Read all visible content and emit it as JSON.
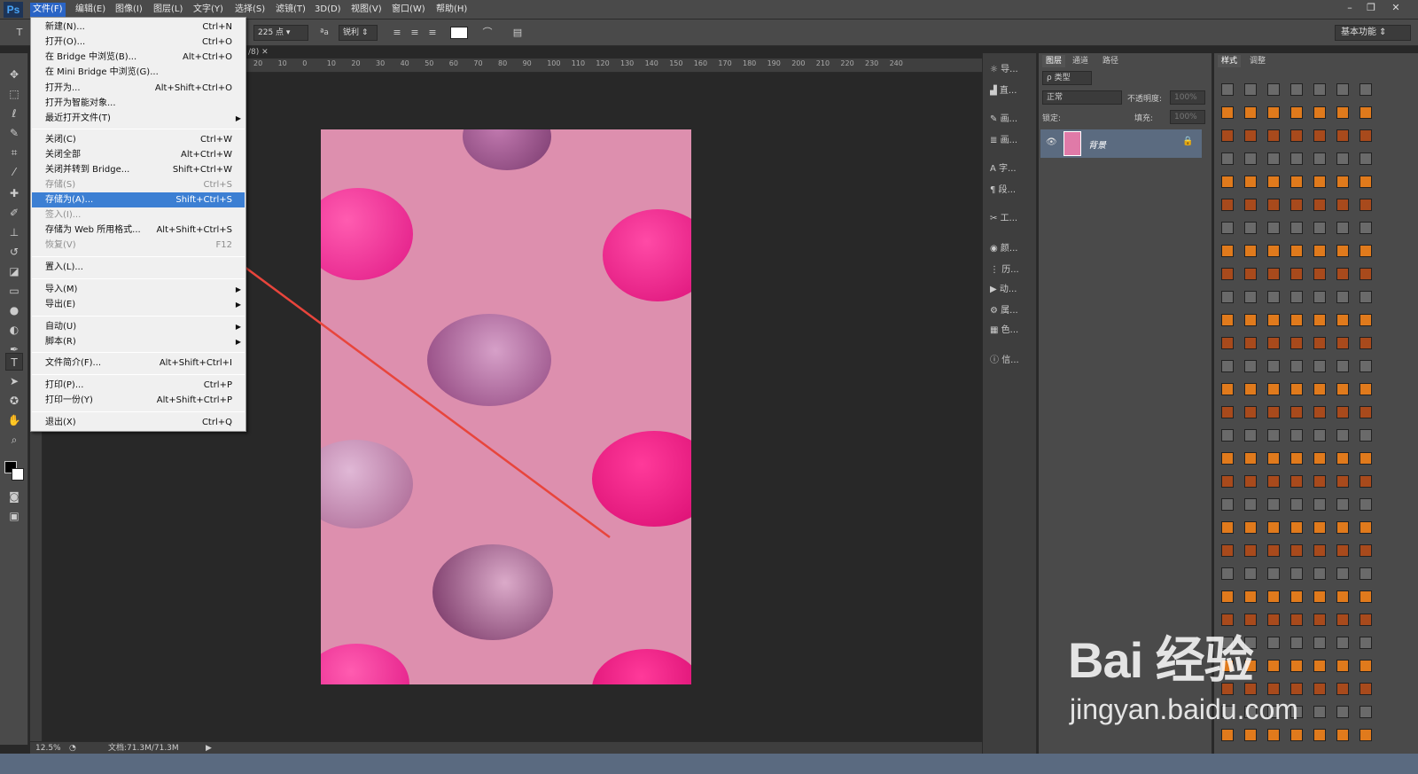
{
  "app": {
    "logo": "Ps",
    "menus": [
      "文件(F)",
      "编辑(E)",
      "图像(I)",
      "图层(L)",
      "文字(Y)",
      "选择(S)",
      "滤镜(T)",
      "3D(D)",
      "视图(V)",
      "窗口(W)",
      "帮助(H)"
    ],
    "active_menu": "文件(F)"
  },
  "options": {
    "font_size": "225 点",
    "aa_label": "ªa",
    "aa_mode": "锐利",
    "workspace": "基本功能"
  },
  "document": {
    "tab_label": "/8)",
    "ruler_ticks": [
      "20",
      "10",
      "0",
      "10",
      "20",
      "30",
      "40",
      "50",
      "60",
      "70",
      "80",
      "90",
      "100",
      "110",
      "120",
      "130",
      "140",
      "150",
      "160",
      "170",
      "180",
      "190",
      "200",
      "210",
      "220",
      "230",
      "240"
    ]
  },
  "status": {
    "zoom": "12.5%",
    "doc_info": "文档:71.3M/71.3M"
  },
  "file_menu": {
    "items": [
      {
        "label": "新建(N)...",
        "shortcut": "Ctrl+N"
      },
      {
        "label": "打开(O)...",
        "shortcut": "Ctrl+O"
      },
      {
        "label": "在 Bridge 中浏览(B)...",
        "shortcut": "Alt+Ctrl+O"
      },
      {
        "label": "在 Mini Bridge 中浏览(G)...",
        "shortcut": ""
      },
      {
        "label": "打开为...",
        "shortcut": "Alt+Shift+Ctrl+O"
      },
      {
        "label": "打开为智能对象...",
        "shortcut": ""
      },
      {
        "label": "最近打开文件(T)",
        "shortcut": ""
      },
      {
        "label": "关闭(C)",
        "shortcut": "Ctrl+W"
      },
      {
        "label": "关闭全部",
        "shortcut": "Alt+Ctrl+W"
      },
      {
        "label": "关闭并转到 Bridge...",
        "shortcut": "Shift+Ctrl+W"
      },
      {
        "label": "存储(S)",
        "shortcut": "Ctrl+S"
      },
      {
        "label": "存储为(A)...",
        "shortcut": "Shift+Ctrl+S"
      },
      {
        "label": "签入(I)...",
        "shortcut": ""
      },
      {
        "label": "存储为 Web 所用格式...",
        "shortcut": "Alt+Shift+Ctrl+S"
      },
      {
        "label": "恢复(V)",
        "shortcut": "F12"
      },
      {
        "label": "置入(L)...",
        "shortcut": ""
      },
      {
        "label": "导入(M)",
        "shortcut": ""
      },
      {
        "label": "导出(E)",
        "shortcut": ""
      },
      {
        "label": "自动(U)",
        "shortcut": ""
      },
      {
        "label": "脚本(R)",
        "shortcut": ""
      },
      {
        "label": "文件简介(F)...",
        "shortcut": "Alt+Shift+Ctrl+I"
      },
      {
        "label": "打印(P)...",
        "shortcut": "Ctrl+P"
      },
      {
        "label": "打印一份(Y)",
        "shortcut": "Alt+Shift+Ctrl+P"
      },
      {
        "label": "退出(X)",
        "shortcut": "Ctrl+Q"
      }
    ]
  },
  "mid_panel": {
    "items": [
      "导...",
      "直...",
      "画...",
      "画...",
      "字...",
      "段...",
      "工...",
      "颜...",
      "历...",
      "动...",
      "属...",
      "色...",
      "信..."
    ]
  },
  "layers_panel": {
    "tabs": [
      "图层",
      "通道",
      "路径"
    ],
    "filter": "ρ 类型",
    "blend_mode": "正常",
    "opacity_label": "不透明度:",
    "opacity_value": "100%",
    "lock_label": "锁定:",
    "fill_label": "填充:",
    "fill_value": "100%",
    "layer_name": "背景"
  },
  "styles_panel": {
    "tabs": [
      "样式",
      "调整"
    ]
  },
  "watermark": {
    "logo": "Bai 经验",
    "url": "jingyan.baidu.com"
  },
  "colors": {
    "highlight": "#3c7fd3",
    "menu_bg": "#f0f0f0",
    "photo_bg": "#dd8fae",
    "arrow": "#e8453c"
  }
}
